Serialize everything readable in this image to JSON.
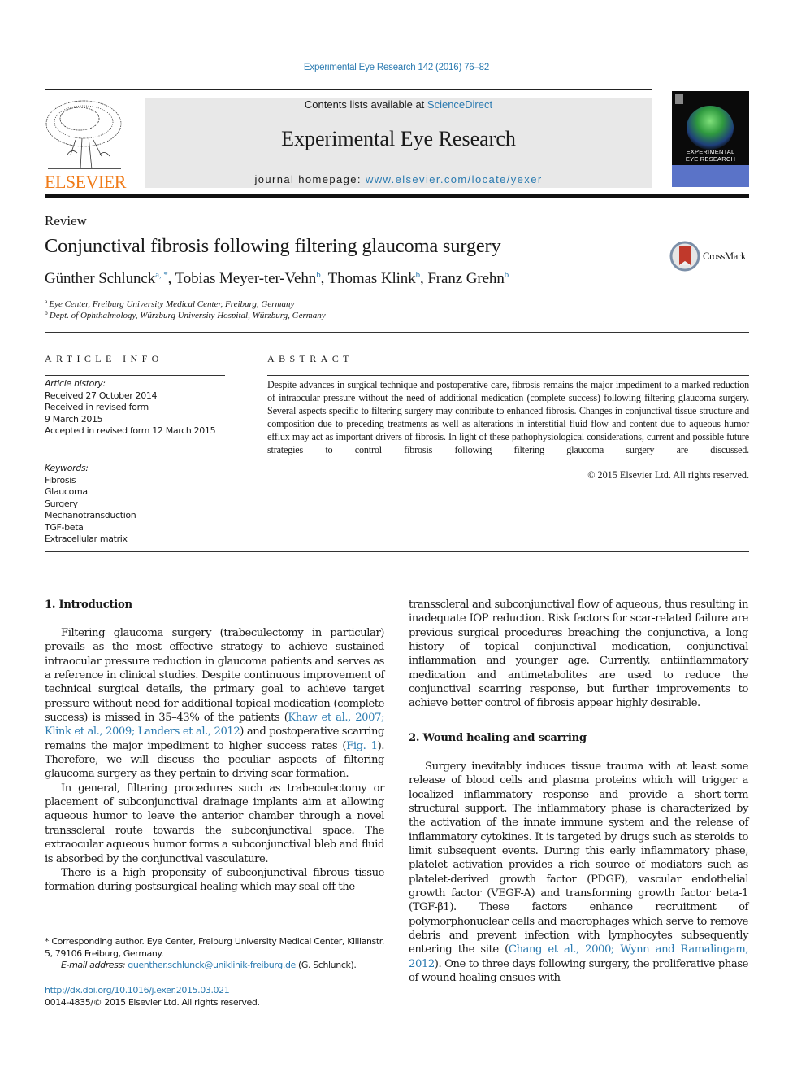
{
  "citation": "Experimental Eye Research 142 (2016) 76–82",
  "header": {
    "publisher": "ELSEVIER",
    "contents_prefix": "Contents lists available at ",
    "contents_link": "ScienceDirect",
    "journal_title": "Experimental Eye Research",
    "homepage_prefix": "journal homepage: ",
    "homepage_link": "www.elsevier.com/locate/yexer",
    "cover_title_line1": "EXPERIMENTAL",
    "cover_title_line2": "EYE RESEARCH"
  },
  "article": {
    "type": "Review",
    "title": "Conjunctival fibrosis following filtering glaucoma surgery",
    "crossmark_label": "CrossMark",
    "authors": [
      {
        "name": "Günther Schlunck",
        "sup": "a, *",
        "sep": ", "
      },
      {
        "name": "Tobias Meyer-ter-Vehn",
        "sup": "b",
        "sep": ", "
      },
      {
        "name": "Thomas Klink",
        "sup": "b",
        "sep": ", "
      },
      {
        "name": "Franz Grehn",
        "sup": "b",
        "sep": ""
      }
    ],
    "affiliations": [
      {
        "label": "a",
        "text": "Eye Center, Freiburg University Medical Center, Freiburg, Germany"
      },
      {
        "label": "b",
        "text": "Dept. of Ophthalmology, Würzburg University Hospital, Würzburg, Germany"
      }
    ]
  },
  "article_info": {
    "heading": "ARTICLE INFO",
    "history_label": "Article history:",
    "history": [
      "Received 27 October 2014",
      "Received in revised form",
      "9 March 2015",
      "Accepted in revised form 12 March 2015"
    ],
    "keywords_label": "Keywords:",
    "keywords": [
      "Fibrosis",
      "Glaucoma",
      "Surgery",
      "Mechanotransduction",
      "TGF-beta",
      "Extracellular matrix"
    ]
  },
  "abstract": {
    "heading": "ABSTRACT",
    "text": "Despite advances in surgical technique and postoperative care, fibrosis remains the major impediment to a marked reduction of intraocular pressure without the need of additional medication (complete success) following filtering glaucoma surgery. Several aspects specific to filtering surgery may contribute to enhanced fibrosis. Changes in conjunctival tissue structure and composition due to preceding treatments as well as alterations in interstitial fluid flow and content due to aqueous humor efflux may act as important drivers of fibrosis. In light of these pathophysiological considerations, current and possible future strategies to control fibrosis following filtering glaucoma surgery are discussed.",
    "copyright": "© 2015 Elsevier Ltd. All rights reserved."
  },
  "sections": {
    "s1": {
      "title": "1.  Introduction",
      "p1_a": "Filtering glaucoma surgery (trabeculectomy in particular) prevails as the most effective strategy to achieve sustained intraocular pressure reduction in glaucoma patients and serves as a reference in clinical studies. Despite continuous improvement of technical surgical details, the primary goal to achieve target pressure without need for additional topical medication (complete success) is missed in 35–43% of the patients (",
      "p1_ref1": "Khaw et al., 2007; Klink et al., 2009; Landers et al., 2012",
      "p1_b": ") and postoperative scarring remains the major impediment to higher success rates (",
      "p1_ref2": "Fig. 1",
      "p1_c": "). Therefore, we will discuss the peculiar aspects of filtering glaucoma surgery as they pertain to driving scar formation.",
      "p2": "In general, filtering procedures such as trabeculectomy or placement of subconjunctival drainage implants aim at allowing aqueous humor to leave the anterior chamber through a novel transscleral route towards the subconjunctival space. The extraocular aqueous humor forms a subconjunctival bleb and fluid is absorbed by the conjunctival vasculature.",
      "p3": "There is a high propensity of subconjunctival fibrous tissue formation during postsurgical healing which may seal off the",
      "p3_cont": "transscleral and subconjunctival flow of aqueous, thus resulting in inadequate IOP reduction. Risk factors for scar-related failure are previous surgical procedures breaching the conjunctiva, a long history of topical conjunctival medication, conjunctival inflammation and younger age. Currently, antiinflammatory medication and antimetabolites are used to reduce the conjunctival scarring response, but further improvements to achieve better control of fibrosis appear highly desirable."
    },
    "s2": {
      "title": "2.  Wound healing and scarring",
      "p1_a": "Surgery inevitably induces tissue trauma with at least some release of blood cells and plasma proteins which will trigger a localized inflammatory response and provide a short-term structural support. The inflammatory phase is characterized by the activation of the innate immune system and the release of inflammatory cytokines. It is targeted by drugs such as steroids to limit subsequent events. During this early inflammatory phase, platelet activation provides a rich source of mediators such as platelet-derived growth factor (PDGF), vascular endothelial growth factor (VEGF-A) and transforming growth factor beta-1 (TGF-β1). These factors enhance recruitment of polymorphonuclear cells and macrophages which serve to remove debris and prevent infection with lymphocytes subsequently entering the site (",
      "p1_ref": "Chang et al., 2000; Wynn and Ramalingam, 2012",
      "p1_b": "). One to three days following surgery, the proliferative phase of wound healing ensues with"
    }
  },
  "footnote": {
    "corresponding": "* Corresponding author. Eye Center, Freiburg University Medical Center, Killianstr. 5, 79106 Freiburg, Germany.",
    "email_label": "E-mail address: ",
    "email": "guenther.schlunck@uniklinik-freiburg.de",
    "email_suffix": " (G. Schlunck).",
    "doi": "http://dx.doi.org/10.1016/j.exer.2015.03.021",
    "issn": "0014-4835/© 2015 Elsevier Ltd. All rights reserved."
  },
  "colors": {
    "link": "#2a7ab0",
    "elsevier_orange": "#f07c1a",
    "header_band": "#e8e8e8"
  }
}
